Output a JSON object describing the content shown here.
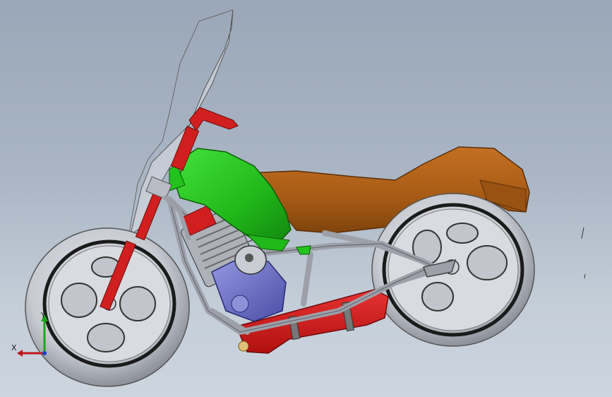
{
  "viewport": {
    "background_top": "#9aa7b8",
    "background_bottom": "#cdd5de"
  },
  "model": {
    "colors": {
      "tank": "#22c31d",
      "seat": "#b6651c",
      "frame_red": "#d11f1f",
      "engine": "#6f73c9",
      "tires": "#c9ccd3",
      "chrome": "#b9bcc4",
      "windshield": "#c8ccd4"
    },
    "icons": [
      "front-wheel-icon",
      "rear-wheel-icon",
      "fuel-tank-icon",
      "seat-icon",
      "engine-icon",
      "exhaust-icon",
      "windshield-icon",
      "handlebar-icon"
    ]
  },
  "triad": {
    "x_label": "X",
    "y_label": "Y",
    "x_color": "#c01818",
    "y_color": "#1aa81a",
    "z_color": "#1a3fc0"
  }
}
